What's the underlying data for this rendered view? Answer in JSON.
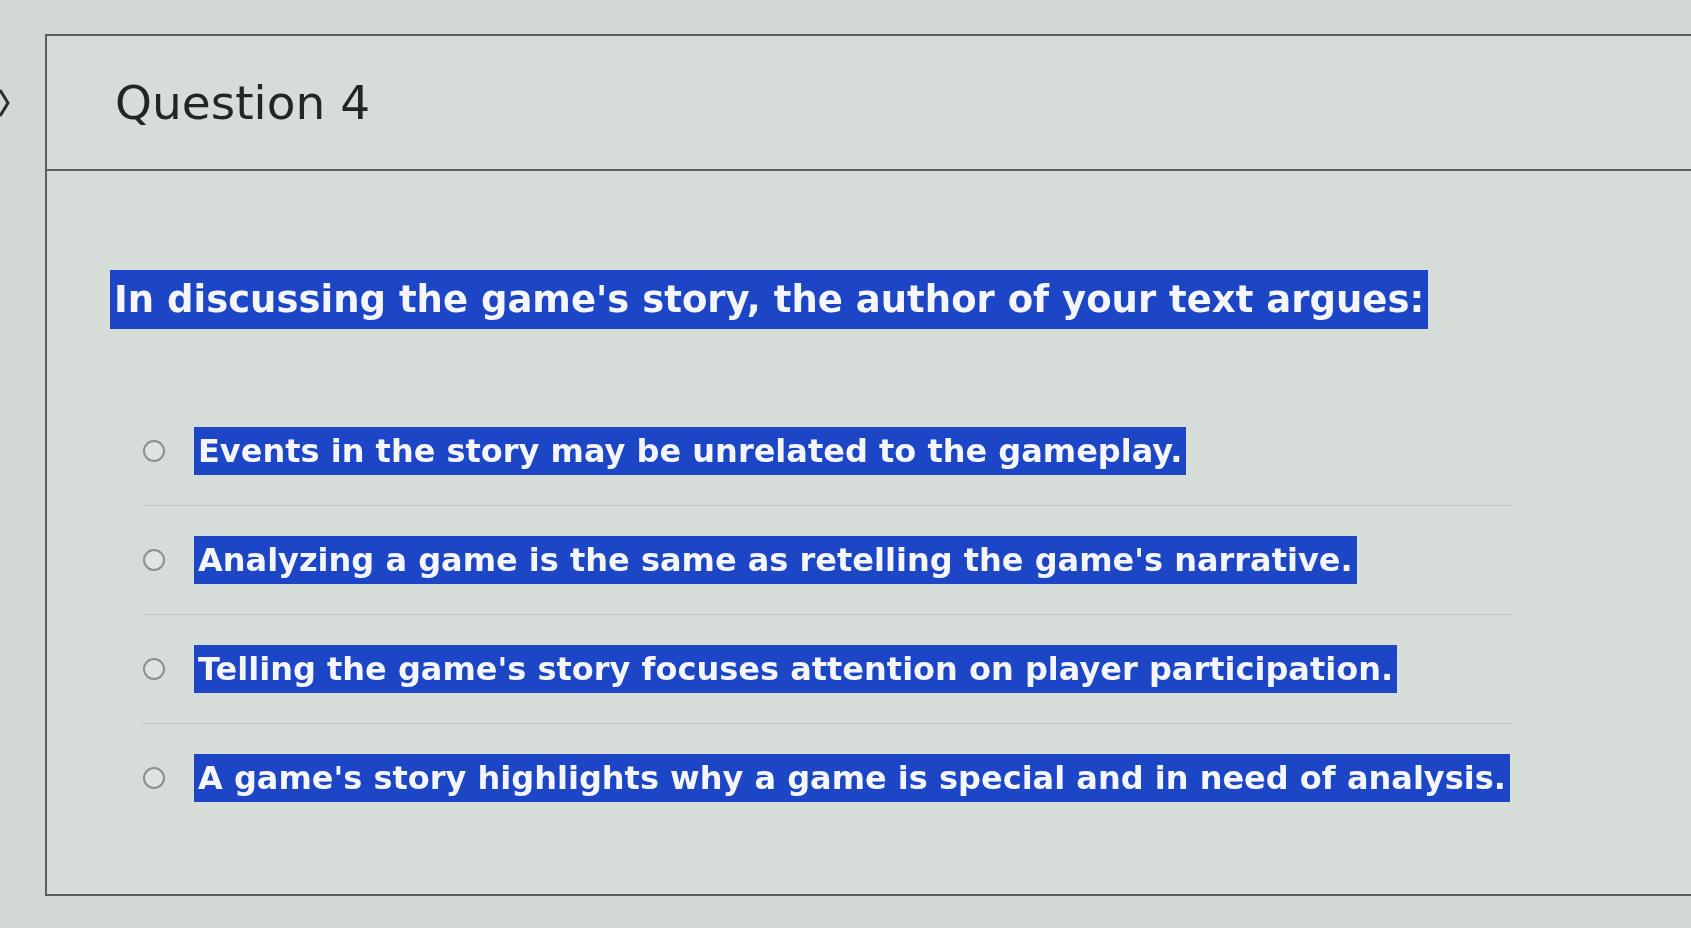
{
  "question": {
    "title": "Question 4",
    "prompt": {
      "text": "In discussing the game's story, the author of your text argues:",
      "highlighted": true
    },
    "options": [
      {
        "label": "Events in the story may be unrelated to the gameplay.",
        "selected": false,
        "highlighted": true
      },
      {
        "label": "Analyzing a game is the same as retelling the game's narrative.",
        "selected": false,
        "highlighted": true
      },
      {
        "label": "Telling the game's story focuses attention on player participation.",
        "selected": false,
        "highlighted": true
      },
      {
        "label": "A game's story highlights why a game is special and in need of analysis.",
        "selected": false,
        "highlighted": true
      }
    ]
  }
}
